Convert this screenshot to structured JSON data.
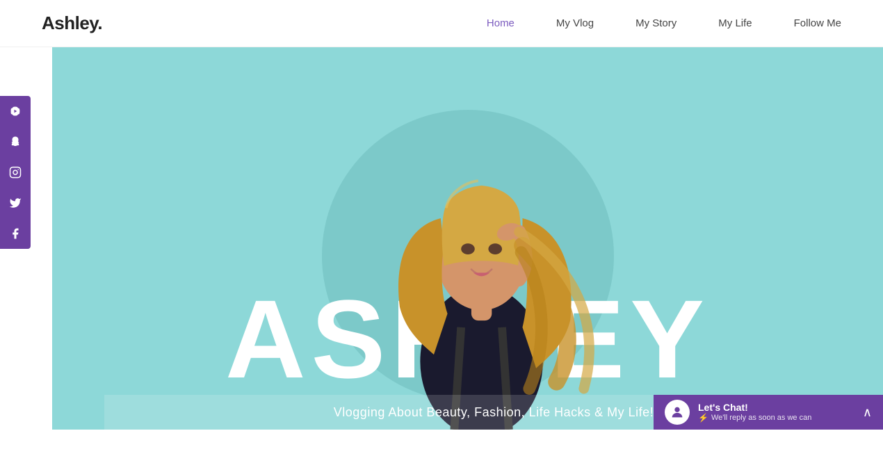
{
  "header": {
    "logo_text": "Ashley.",
    "nav_items": [
      {
        "label": "Home",
        "active": true
      },
      {
        "label": "My Vlog",
        "active": false
      },
      {
        "label": "My Story",
        "active": false
      },
      {
        "label": "My Life",
        "active": false
      },
      {
        "label": "Follow Me",
        "active": false
      }
    ]
  },
  "social_sidebar": {
    "icons": [
      {
        "name": "youtube",
        "symbol": "▶"
      },
      {
        "name": "snapchat",
        "symbol": "👻"
      },
      {
        "name": "instagram",
        "symbol": "◎"
      },
      {
        "name": "twitter",
        "symbol": "🐦"
      },
      {
        "name": "facebook",
        "symbol": "f"
      }
    ]
  },
  "hero": {
    "background_color": "#8dd8d8",
    "big_title": "ASHLEY",
    "subtitle": "Vlogging About Beauty, Fashion, Life Hacks & My Life!"
  },
  "chat_widget": {
    "title": "Let's Chat!",
    "subtitle": "We'll reply as soon as we can",
    "lightning": "⚡"
  },
  "colors": {
    "purple": "#6b3fa0",
    "teal": "#8dd8d8",
    "white": "#ffffff"
  }
}
